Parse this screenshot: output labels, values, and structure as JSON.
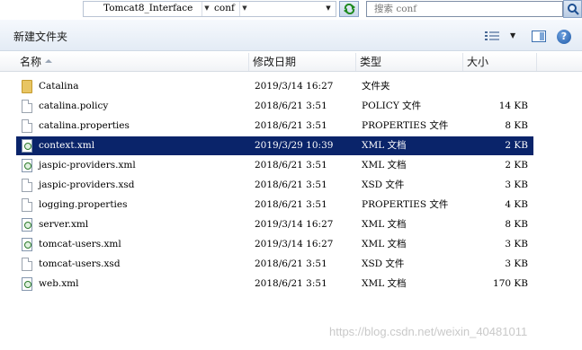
{
  "address": {
    "crumbs": [
      "Tomcat8_Interface",
      "conf"
    ],
    "search_placeholder": "搜索 conf"
  },
  "toolbar": {
    "new_folder_label": "新建文件夹",
    "help_label": "?"
  },
  "columns": {
    "name": "名称",
    "date": "修改日期",
    "type": "类型",
    "size": "大小"
  },
  "files": [
    {
      "name": "Catalina",
      "date": "2019/3/14 16:27",
      "type": "文件夹",
      "size": "",
      "icon": "folder-icon"
    },
    {
      "name": "catalina.policy",
      "date": "2018/6/21 3:51",
      "type": "POLICY 文件",
      "size": "14 KB",
      "icon": "document-icon"
    },
    {
      "name": "catalina.properties",
      "date": "2018/6/21 3:51",
      "type": "PROPERTIES 文件",
      "size": "8 KB",
      "icon": "document-icon"
    },
    {
      "name": "context.xml",
      "date": "2019/3/29 10:39",
      "type": "XML 文档",
      "size": "2 KB",
      "icon": "xml-file-icon",
      "selected": true
    },
    {
      "name": "jaspic-providers.xml",
      "date": "2018/6/21 3:51",
      "type": "XML 文档",
      "size": "2 KB",
      "icon": "xml-file-icon"
    },
    {
      "name": "jaspic-providers.xsd",
      "date": "2018/6/21 3:51",
      "type": "XSD 文件",
      "size": "3 KB",
      "icon": "document-icon"
    },
    {
      "name": "logging.properties",
      "date": "2018/6/21 3:51",
      "type": "PROPERTIES 文件",
      "size": "4 KB",
      "icon": "document-icon"
    },
    {
      "name": "server.xml",
      "date": "2019/3/14 16:27",
      "type": "XML 文档",
      "size": "8 KB",
      "icon": "xml-file-icon"
    },
    {
      "name": "tomcat-users.xml",
      "date": "2019/3/14 16:27",
      "type": "XML 文档",
      "size": "3 KB",
      "icon": "xml-file-icon"
    },
    {
      "name": "tomcat-users.xsd",
      "date": "2018/6/21 3:51",
      "type": "XSD 文件",
      "size": "3 KB",
      "icon": "document-icon"
    },
    {
      "name": "web.xml",
      "date": "2018/6/21 3:51",
      "type": "XML 文档",
      "size": "170 KB",
      "icon": "xml-file-icon"
    }
  ],
  "watermark": "https://blog.csdn.net/weixin_40481011",
  "colors": {
    "selection": "#0a246a",
    "folder": "#e8c563",
    "header_bg": "#e3ebf5"
  }
}
